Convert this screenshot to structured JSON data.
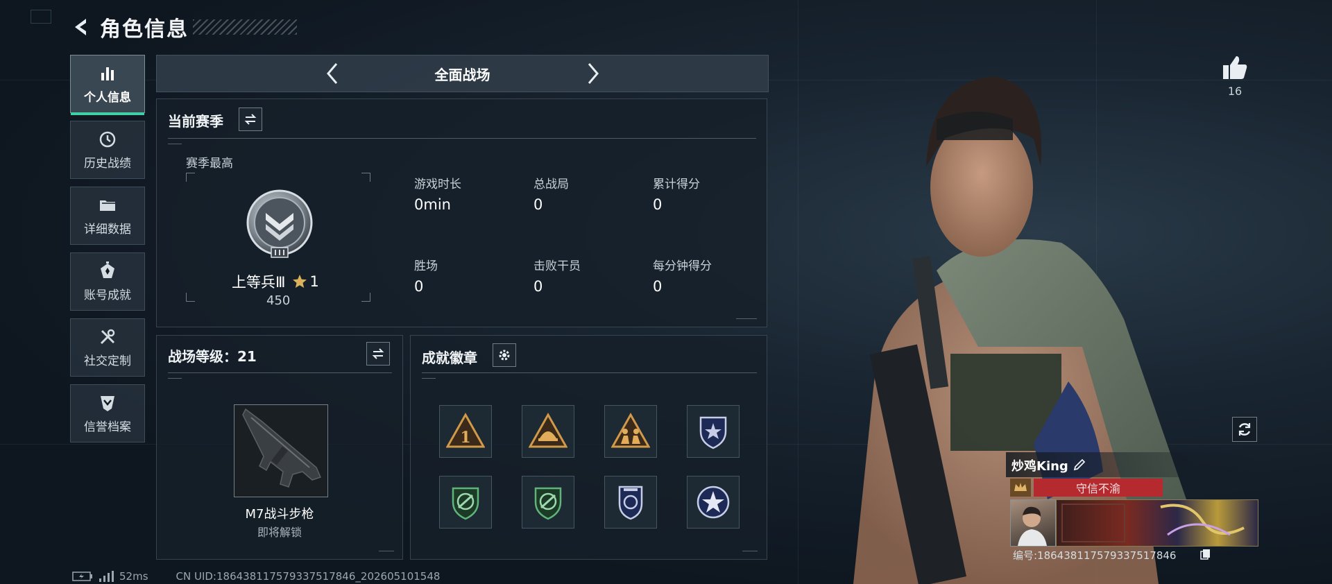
{
  "header": {
    "title": "角色信息"
  },
  "nav": {
    "items": [
      {
        "label": "个人信息",
        "icon": "bar-chart-icon",
        "active": true
      },
      {
        "label": "历史战绩",
        "icon": "clock-icon",
        "active": false
      },
      {
        "label": "详细数据",
        "icon": "folder-icon",
        "active": false
      },
      {
        "label": "账号成就",
        "icon": "achievement-icon",
        "active": false
      },
      {
        "label": "社交定制",
        "icon": "tools-icon",
        "active": false
      },
      {
        "label": "信誉档案",
        "icon": "shield-check-icon",
        "active": false
      }
    ]
  },
  "mode": {
    "title": "全面战场"
  },
  "season": {
    "title": "当前赛季",
    "best_label": "赛季最高",
    "rank_name": "上等兵Ⅲ",
    "rank_stars": "1",
    "rank_points": "450",
    "stats": [
      {
        "label": "游戏时长",
        "value": "0min"
      },
      {
        "label": "总战局",
        "value": "0"
      },
      {
        "label": "累计得分",
        "value": "0"
      },
      {
        "label": "胜场",
        "value": "0"
      },
      {
        "label": "击败干员",
        "value": "0"
      },
      {
        "label": "每分钟得分",
        "value": "0"
      }
    ]
  },
  "level": {
    "title": "战场等级：21",
    "weapon_name": "M7战斗步枪",
    "weapon_status": "即将解锁"
  },
  "badges": {
    "title": "成就徽章",
    "items": [
      "triangle-1-badge-icon",
      "triangle-helmet-badge-icon",
      "triangle-soldiers-badge-icon",
      "blue-shield-badge-icon",
      "green-shield-badge-icon",
      "green-shield-badge-icon",
      "blue-police-badge-icon",
      "blue-star-badge-icon"
    ]
  },
  "side": {
    "likes": "16"
  },
  "player": {
    "name": "炒鸡King",
    "motto": "守信不渝",
    "id_text": "编号:18643811757933751784​6"
  },
  "footer": {
    "ping": "52ms",
    "uid": "CN UID:18643811757933751784​6_202605101548"
  },
  "colors": {
    "accent": "#3fd0a6",
    "motto_bg": "#b42a2e"
  }
}
